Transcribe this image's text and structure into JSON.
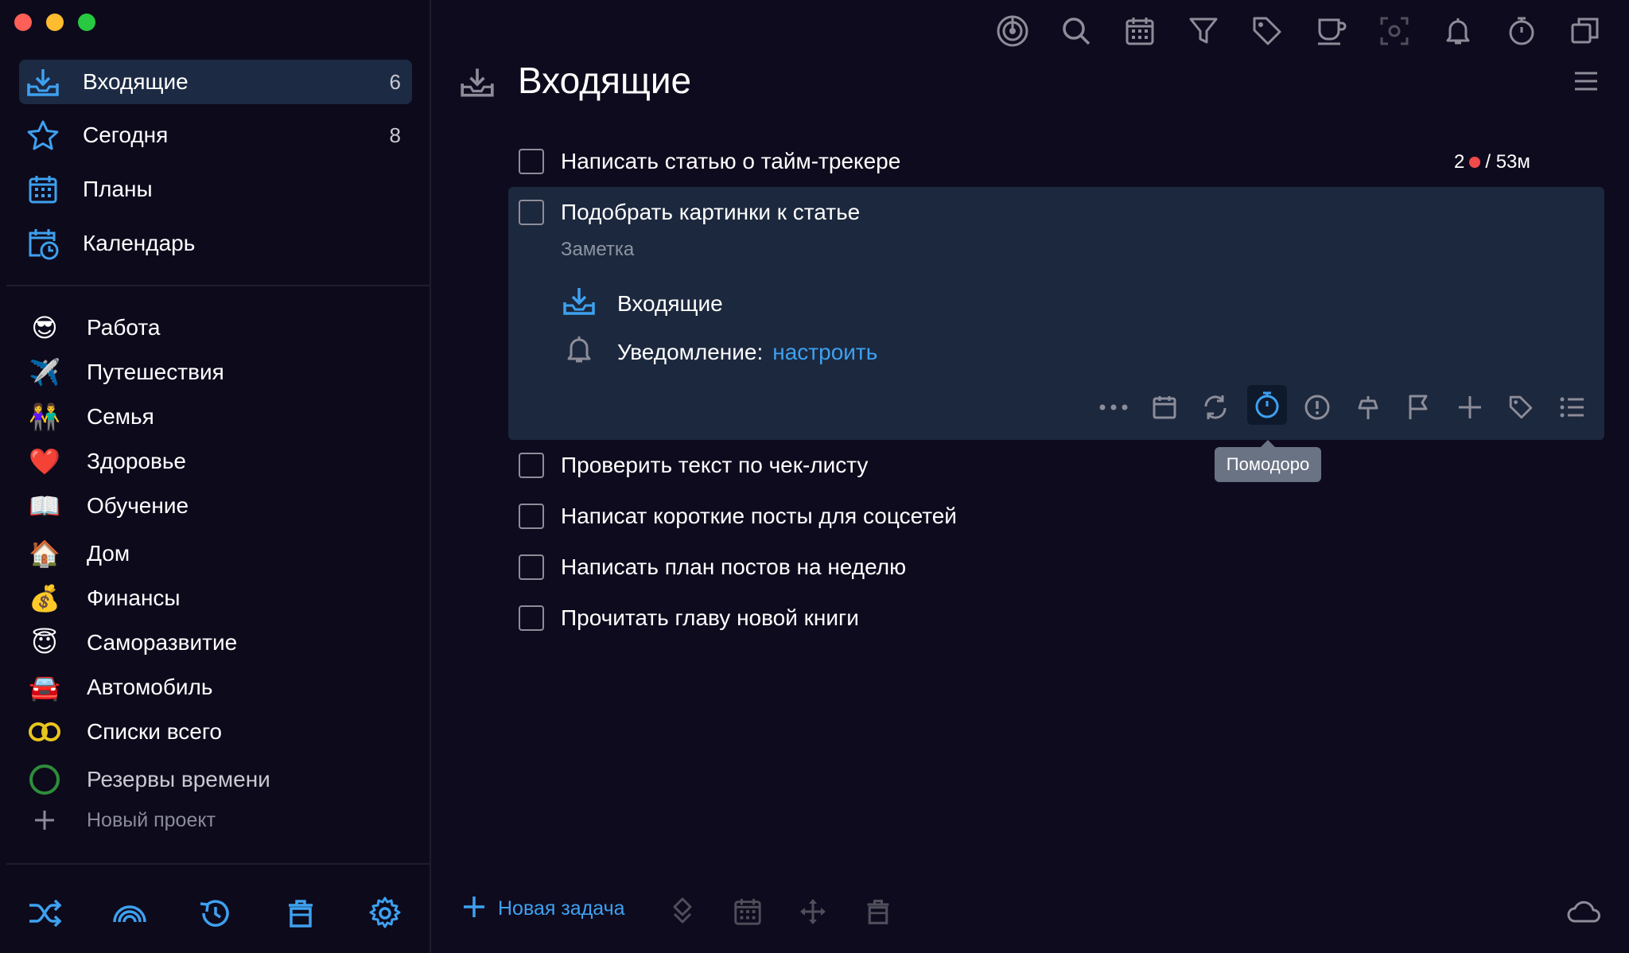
{
  "colors": {
    "accent": "#3ea1f0",
    "background": "#0f0b1e",
    "selected_row": "#1c2a44",
    "pomodoro_dot": "#f04a4a"
  },
  "sidebar": {
    "nav": [
      {
        "label": "Входящие",
        "count": "6",
        "icon": "inbox-icon"
      },
      {
        "label": "Сегодня",
        "count": "8",
        "icon": "star-icon"
      },
      {
        "label": "Планы",
        "count": "",
        "icon": "calendar-grid-icon"
      },
      {
        "label": "Календарь",
        "count": "",
        "icon": "calendar-clock-icon"
      }
    ],
    "projects": [
      {
        "label": "Работа",
        "emoji": "😎"
      },
      {
        "label": "Путешествия",
        "emoji": "✈️"
      },
      {
        "label": "Семья",
        "emoji": "👫"
      },
      {
        "label": "Здоровье",
        "emoji": "❤️"
      },
      {
        "label": "Обучение",
        "emoji": "📖"
      },
      {
        "label": "Дом",
        "emoji": "🏠"
      },
      {
        "label": "Финансы",
        "emoji": "💰"
      },
      {
        "label": "Саморазвитие",
        "emoji": "😇"
      },
      {
        "label": "Автомобиль",
        "emoji": "🚘"
      },
      {
        "label": "Списки всего",
        "emoji": "∞"
      },
      {
        "label": "Резервы времени",
        "emoji": "◯"
      }
    ],
    "new_project": "Новый проект"
  },
  "main": {
    "title": "Входящие",
    "tasks": [
      {
        "text": "Написать статью о тайм-трекере"
      },
      {
        "text": "Подобрать картинки к статье"
      },
      {
        "text": "Проверить текст по чек-листу"
      },
      {
        "text": "Написат короткие посты для соцсетей"
      },
      {
        "text": "Написать план постов на неделю"
      },
      {
        "text": "Прочитать главу новой книги"
      }
    ],
    "pomodoro": {
      "count": "2",
      "time": "/ 53м"
    },
    "expanded": {
      "note_placeholder": "Заметка",
      "project": "Входящие",
      "reminder_label": "Уведомление:",
      "reminder_link": "настроить"
    },
    "tooltip": "Помодоро",
    "new_task": "Новая задача"
  }
}
